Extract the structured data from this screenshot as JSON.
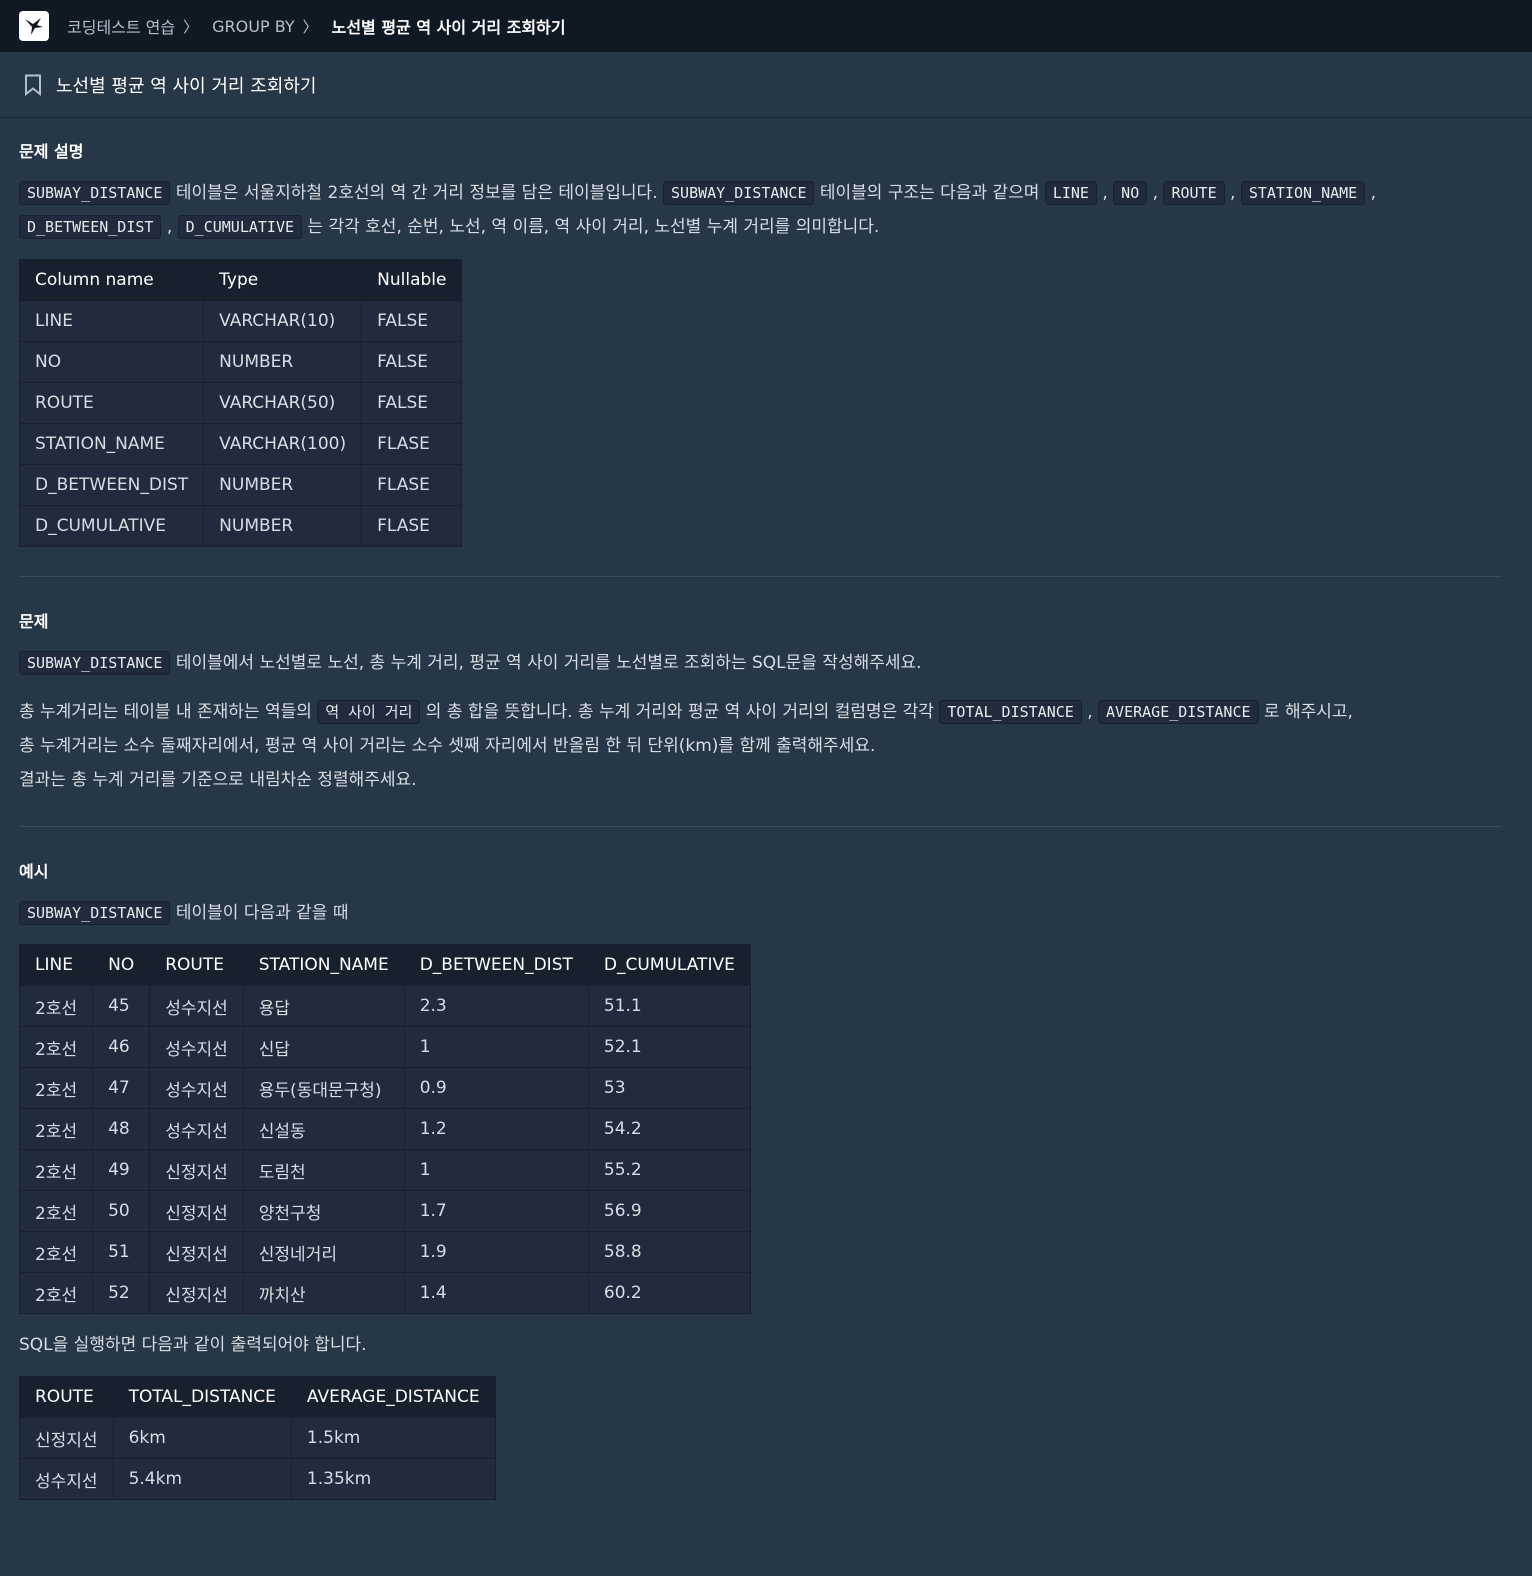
{
  "breadcrumb": [
    "코딩테스트 연습",
    "GROUP BY",
    "노선별 평균 역 사이 거리 조회하기"
  ],
  "title": "노선별 평균 역 사이 거리 조회하기",
  "desc": {
    "heading": "문제 설명",
    "line1": [
      {
        "code": "SUBWAY_DISTANCE"
      },
      {
        "text": " 테이블은 서울지하철 2호선의 역 간 거리 정보를 담은 테이블입니다. "
      },
      {
        "code": "SUBWAY_DISTANCE"
      },
      {
        "text": " 테이블의 구조는 다음과 같으며 "
      },
      {
        "code": "LINE"
      },
      {
        "text": " , "
      },
      {
        "code": "NO"
      },
      {
        "text": " , "
      },
      {
        "code": "ROUTE"
      },
      {
        "text": " , "
      },
      {
        "code": "STATION_NAME"
      },
      {
        "text": " ,"
      }
    ],
    "line2": [
      {
        "code": "D_BETWEEN_DIST"
      },
      {
        "text": " , "
      },
      {
        "code": "D_CUMULATIVE"
      },
      {
        "text": " 는 각각 호선, 순번, 노선, 역 이름, 역 사이 거리, 노선별 누계 거리를 의미합니다."
      }
    ],
    "schema": {
      "headers": [
        "Column name",
        "Type",
        "Nullable"
      ],
      "rows": [
        [
          "LINE",
          "VARCHAR(10)",
          "FALSE"
        ],
        [
          "NO",
          "NUMBER",
          "FALSE"
        ],
        [
          "ROUTE",
          "VARCHAR(50)",
          "FALSE"
        ],
        [
          "STATION_NAME",
          "VARCHAR(100)",
          "FLASE"
        ],
        [
          "D_BETWEEN_DIST",
          "NUMBER",
          "FLASE"
        ],
        [
          "D_CUMULATIVE",
          "NUMBER",
          "FLASE"
        ]
      ]
    }
  },
  "problem": {
    "heading": "문제",
    "line1": [
      {
        "code": "SUBWAY_DISTANCE"
      },
      {
        "text": " 테이블에서 노선별로 노선, 총 누계 거리, 평균 역 사이 거리를 노선별로 조회하는 SQL문을 작성해주세요."
      }
    ],
    "line2": [
      {
        "text": "총 누계거리는 테이블 내 존재하는 역들의 "
      },
      {
        "code": "역 사이 거리"
      },
      {
        "text": " 의 총 합을 뜻합니다. 총 누계 거리와 평균 역 사이 거리의 컬럼명은 각각 "
      },
      {
        "code": "TOTAL_DISTANCE"
      },
      {
        "text": " , "
      },
      {
        "code": "AVERAGE_DISTANCE"
      },
      {
        "text": " 로 해주시고,"
      }
    ],
    "line3": "총 누계거리는 소수 둘째자리에서, 평균 역 사이 거리는 소수 셋째 자리에서 반올림 한 뒤 단위(km)를 함께 출력해주세요.",
    "line4": "결과는 총 누계 거리를 기준으로 내림차순 정렬해주세요."
  },
  "example": {
    "heading": "예시",
    "intro": [
      {
        "code": "SUBWAY_DISTANCE"
      },
      {
        "text": " 테이블이 다음과 같을 때"
      }
    ],
    "table": {
      "headers": [
        "LINE",
        "NO",
        "ROUTE",
        "STATION_NAME",
        "D_BETWEEN_DIST",
        "D_CUMULATIVE"
      ],
      "rows": [
        [
          "2호선",
          "45",
          "성수지선",
          "용답",
          "2.3",
          "51.1"
        ],
        [
          "2호선",
          "46",
          "성수지선",
          "신답",
          "1",
          "52.1"
        ],
        [
          "2호선",
          "47",
          "성수지선",
          "용두(동대문구청)",
          "0.9",
          "53"
        ],
        [
          "2호선",
          "48",
          "성수지선",
          "신설동",
          "1.2",
          "54.2"
        ],
        [
          "2호선",
          "49",
          "신정지선",
          "도림천",
          "1",
          "55.2"
        ],
        [
          "2호선",
          "50",
          "신정지선",
          "양천구청",
          "1.7",
          "56.9"
        ],
        [
          "2호선",
          "51",
          "신정지선",
          "신정네거리",
          "1.9",
          "58.8"
        ],
        [
          "2호선",
          "52",
          "신정지선",
          "까치산",
          "1.4",
          "60.2"
        ]
      ]
    },
    "result_intro": "SQL을 실행하면 다음과 같이 출력되어야 합니다.",
    "result": {
      "headers": [
        "ROUTE",
        "TOTAL_DISTANCE",
        "AVERAGE_DISTANCE"
      ],
      "rows": [
        [
          "신정지선",
          "6km",
          "1.5km"
        ],
        [
          "성수지선",
          "5.4km",
          "1.35km"
        ]
      ]
    }
  }
}
